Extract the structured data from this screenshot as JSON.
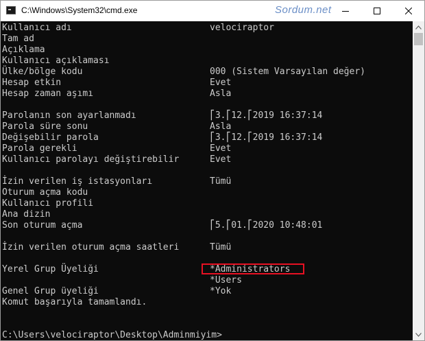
{
  "window": {
    "title": "C:\\Windows\\System32\\cmd.exe",
    "watermark": "Sordum.net"
  },
  "terminal": {
    "rows": [
      {
        "label": "Kullanıcı adı",
        "value": "velociraptor"
      },
      {
        "label": "Tam ad",
        "value": ""
      },
      {
        "label": "Açıklama",
        "value": ""
      },
      {
        "label": "Kullanıcı açıklaması",
        "value": ""
      },
      {
        "label": "Ülke/bölge kodu",
        "value": "000 (Sistem Varsayılan değer)"
      },
      {
        "label": "Hesap etkin",
        "value": "Evet"
      },
      {
        "label": "Hesap zaman aşımı",
        "value": "Asla"
      },
      {
        "label": "",
        "value": ""
      },
      {
        "label": "Parolanın son ayarlanmadı",
        "value": "⎡3.⎡12.⎡2019 16:37:14"
      },
      {
        "label": "Parola süre sonu",
        "value": "Asla"
      },
      {
        "label": "Değişebilir parola",
        "value": "⎡3.⎡12.⎡2019 16:37:14"
      },
      {
        "label": "Parola gerekli",
        "value": "Evet"
      },
      {
        "label": "Kullanıcı parolayı değiştirebilir",
        "value": "Evet"
      },
      {
        "label": "",
        "value": ""
      },
      {
        "label": "İzin verilen iş istasyonları",
        "value": "Tümü"
      },
      {
        "label": "Oturum açma kodu",
        "value": ""
      },
      {
        "label": "Kullanıcı profili",
        "value": ""
      },
      {
        "label": "Ana dizin",
        "value": ""
      },
      {
        "label": "Son oturum açma",
        "value": "⎡5.⎡01.⎡2020 10:48:01"
      },
      {
        "label": "",
        "value": ""
      },
      {
        "label": "İzin verilen oturum açma saatleri",
        "value": "Tümü"
      },
      {
        "label": "",
        "value": ""
      },
      {
        "label": "Yerel Grup Üyeliği",
        "value": "*Administrators"
      },
      {
        "label": "",
        "value": "*Users"
      },
      {
        "label": "Genel Grup üyeliği",
        "value": "*Yok"
      },
      {
        "label": "Komut başarıyla tamamlandı.",
        "value": ""
      },
      {
        "label": "",
        "value": ""
      },
      {
        "label": "",
        "value": ""
      },
      {
        "label": "C:\\Users\\velociraptor\\Desktop\\Adminmiyim>",
        "value": ""
      }
    ]
  },
  "colors": {
    "background": "#0c0c0c",
    "text": "#cccccc",
    "highlight_border": "#e81123",
    "watermark": "#6b8fc7"
  },
  "icons": {
    "app": "cmd-icon",
    "minimize": "minimize-icon",
    "maximize": "maximize-icon",
    "close": "close-icon"
  }
}
